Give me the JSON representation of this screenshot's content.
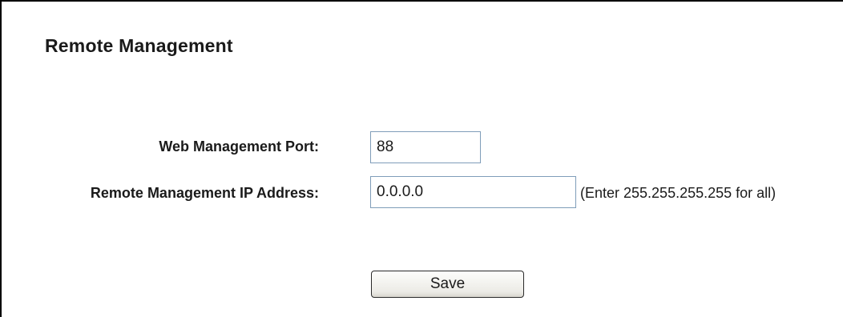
{
  "page": {
    "title": "Remote Management"
  },
  "form": {
    "port_label": "Web Management Port:",
    "port_value": "88",
    "ip_label": "Remote Management IP Address:",
    "ip_value": "0.0.0.0",
    "ip_hint": "(Enter 255.255.255.255 for all)",
    "save_label": "Save"
  }
}
